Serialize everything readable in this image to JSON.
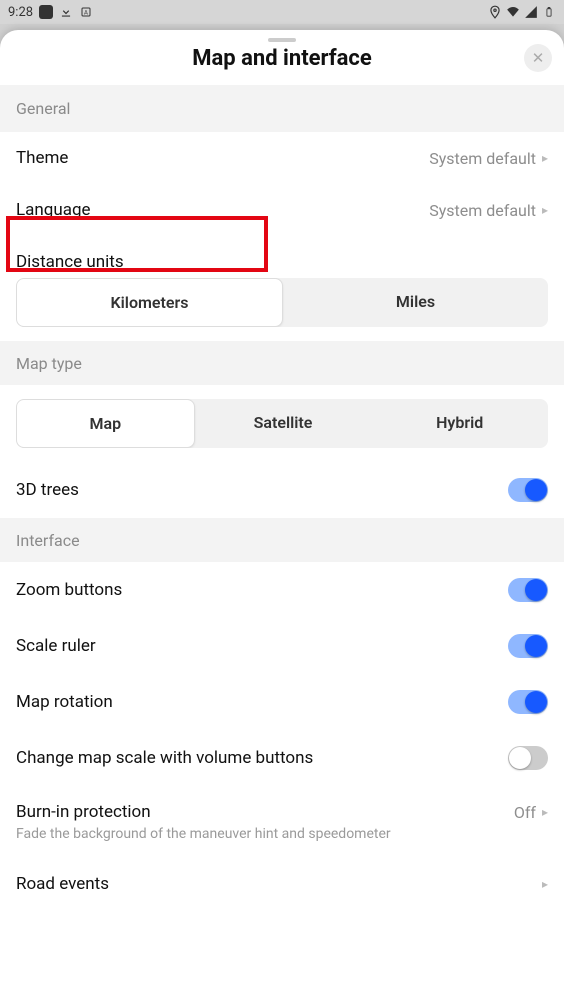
{
  "status": {
    "time": "9:28",
    "icons_left": [
      "app-square",
      "download-icon",
      "notif-icon"
    ],
    "icons_right": [
      "location-icon",
      "wifi-icon",
      "signal-icon",
      "battery-icon"
    ]
  },
  "sheet": {
    "title": "Map and interface"
  },
  "general": {
    "header": "General",
    "theme": {
      "label": "Theme",
      "value": "System default"
    },
    "language": {
      "label": "Language",
      "value": "System default"
    },
    "distance_units": {
      "label": "Distance units",
      "options": [
        "Kilometers",
        "Miles"
      ],
      "selected": 0
    }
  },
  "map_type": {
    "header": "Map type",
    "options": [
      "Map",
      "Satellite",
      "Hybrid"
    ],
    "selected": 0,
    "trees_3d": {
      "label": "3D trees",
      "on": true
    }
  },
  "interface": {
    "header": "Interface",
    "zoom_buttons": {
      "label": "Zoom buttons",
      "on": true
    },
    "scale_ruler": {
      "label": "Scale ruler",
      "on": true
    },
    "map_rotation": {
      "label": "Map rotation",
      "on": true
    },
    "scale_volume": {
      "label": "Change map scale with volume buttons",
      "on": false
    },
    "burn_in": {
      "label": "Burn-in protection",
      "sub": "Fade the background of the maneuver hint and speedometer",
      "value": "Off"
    },
    "road_events": {
      "label": "Road events"
    }
  }
}
